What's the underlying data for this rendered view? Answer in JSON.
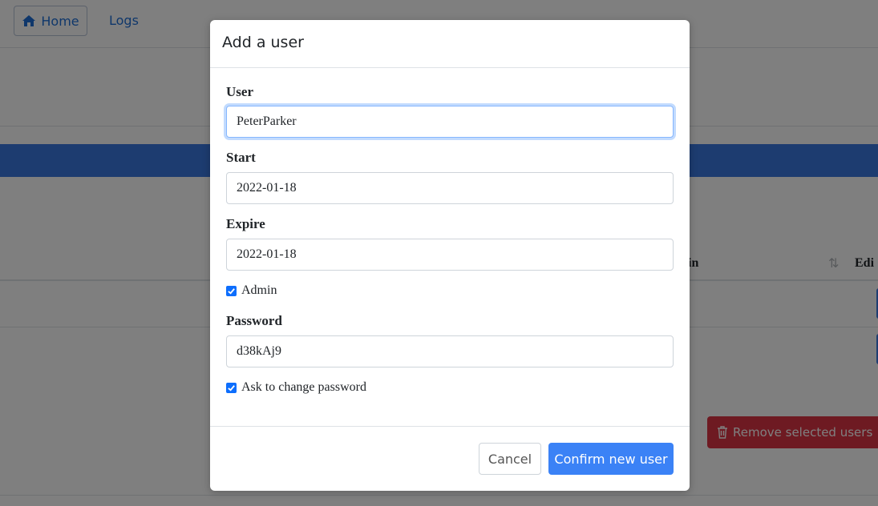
{
  "nav": {
    "home_label": "Home",
    "logs_label": "Logs"
  },
  "table": {
    "col_admin": "in",
    "col_edit": "Edi"
  },
  "actions": {
    "remove_label": "Remove selected users"
  },
  "modal": {
    "title": "Add a user",
    "user_label": "User",
    "user_value": "PeterParker",
    "start_label": "Start",
    "start_value": "2022-01-18",
    "expire_label": "Expire",
    "expire_value": "2022-01-18",
    "admin_label": "Admin",
    "admin_checked": true,
    "password_label": "Password",
    "password_value": "d38kAj9",
    "ask_change_label": "Ask to change password",
    "ask_change_checked": true,
    "cancel_label": "Cancel",
    "confirm_label": "Confirm new user"
  }
}
